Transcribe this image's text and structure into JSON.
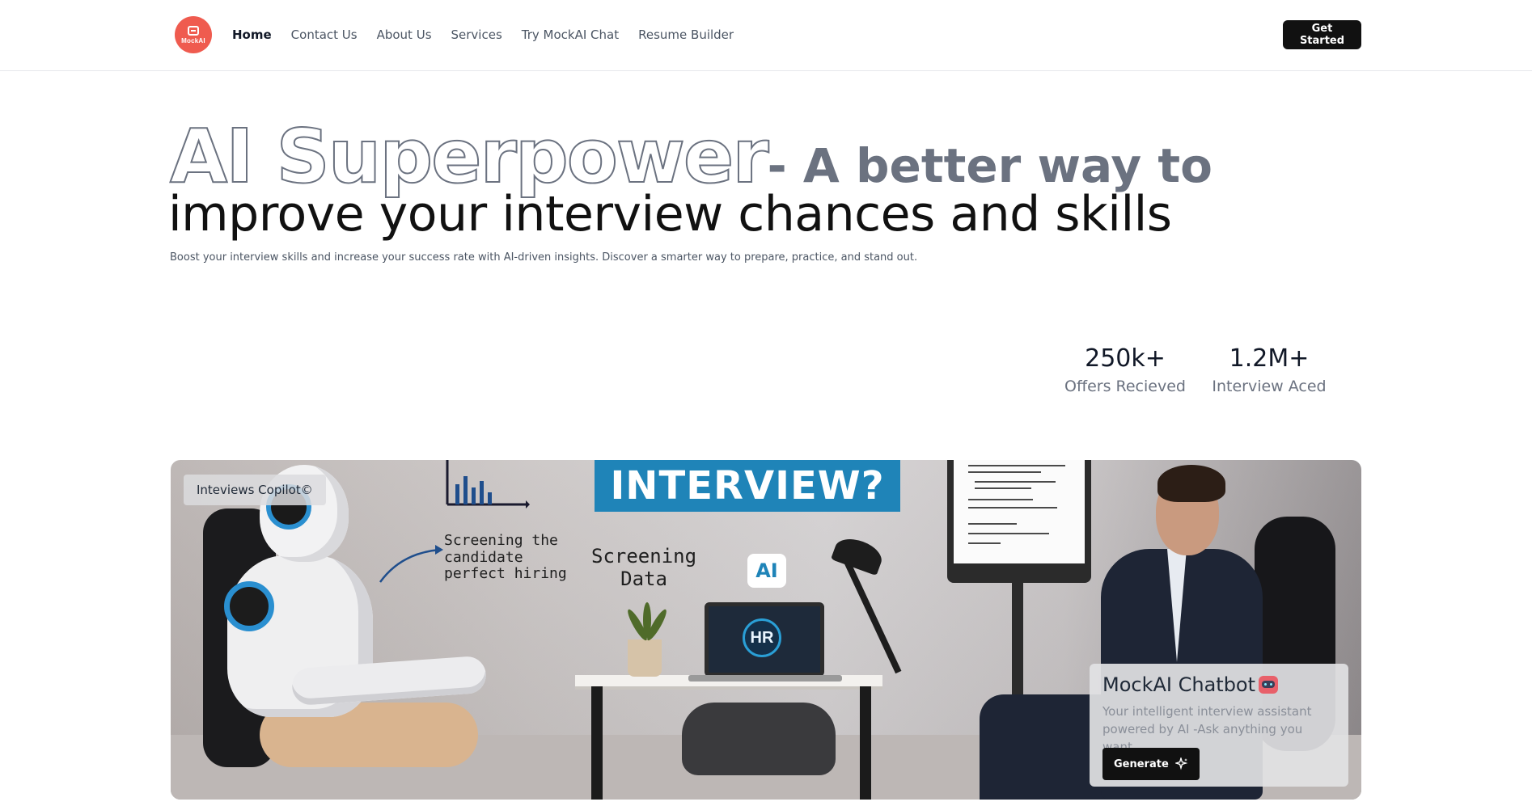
{
  "header": {
    "logo_text": "MockAI",
    "nav": [
      {
        "label": "Home",
        "active": true
      },
      {
        "label": "Contact Us"
      },
      {
        "label": "About Us"
      },
      {
        "label": "Services"
      },
      {
        "label": "Try MockAI Chat"
      },
      {
        "label": "Resume Builder"
      }
    ],
    "cta_label": "Get Started"
  },
  "hero": {
    "title_outline": "AI Superpower",
    "title_rest": "- A better way to",
    "title_line2": "improve your interview chances and skills",
    "subtitle": "Boost your interview skills and increase your success rate with AI-driven insights. Discover a smarter way to prepare, practice, and stand out."
  },
  "stats": [
    {
      "value": "250k+",
      "label": "Offers Recieved"
    },
    {
      "value": "1.2M+",
      "label": "Interview Aced"
    }
  ],
  "banner": {
    "badge": "Inteviews Copilot©",
    "sign_text": "INTERVIEW?",
    "note_screening_candidate": [
      "Screening the",
      "candidate",
      "perfect hiring"
    ],
    "note_screening_data": [
      "Screening",
      "Data"
    ],
    "ai_bubble": "AI",
    "laptop_badge": "HR"
  },
  "chatbot": {
    "title": "MockAI Chatbot",
    "description": "Your intelligent interview assistant powered by AI -Ask anything you want.",
    "button_label": "Generate"
  },
  "colors": {
    "logo": "#ef5b4f",
    "cta": "#111111",
    "sign": "#1f84b8"
  }
}
